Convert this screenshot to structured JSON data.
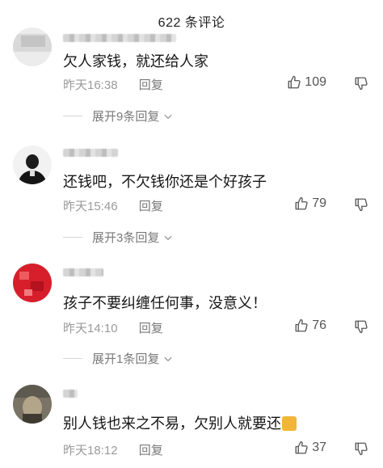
{
  "header": {
    "title": "622 条评论"
  },
  "comments": [
    {
      "text": "欠人家钱，就还给人家",
      "time": "昨天16:38",
      "reply_label": "回复",
      "likes": "109",
      "expand_label": "展开9条回复"
    },
    {
      "text": "还钱吧，不欠钱你还是个好孩子",
      "time": "昨天15:46",
      "reply_label": "回复",
      "likes": "79",
      "expand_label": "展开3条回复"
    },
    {
      "text": "孩子不要纠缠任何事，没意义！",
      "time": "昨天14:10",
      "reply_label": "回复",
      "likes": "76",
      "expand_label": "展开1条回复"
    },
    {
      "text": "别人钱也来之不易，欠别人就要还",
      "time": "昨天18:12",
      "reply_label": "回复",
      "likes": "37"
    }
  ],
  "icons": {
    "like": "thumbs-up-icon",
    "dislike": "thumbs-down-icon",
    "expand": "chevron-down-icon",
    "emoji": "emoji-icon"
  },
  "colors": {
    "text": "#161616",
    "meta": "#9a9a9a",
    "accent_red": "#d61f2b"
  }
}
